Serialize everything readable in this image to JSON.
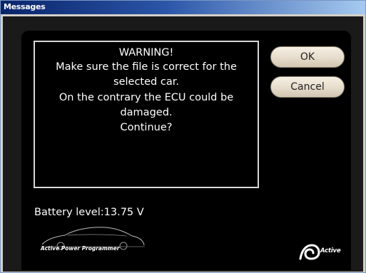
{
  "window": {
    "title": "Messages"
  },
  "message": {
    "lines": [
      "WARNING!",
      "Make sure the file is correct for the",
      "selected car.",
      "On the contrary the ECU could be",
      "damaged.",
      "Continue?"
    ]
  },
  "buttons": {
    "ok_label": "OK",
    "cancel_label": "Cancel"
  },
  "status": {
    "battery_text": "Battery level:13.75 V"
  },
  "branding": {
    "app_name": "Active Power Programmer",
    "brand_name": "Active",
    "car_icon": "car-silhouette-icon",
    "brand_icon": "active-brand-icon"
  },
  "colors": {
    "title_bar": "#0a246a",
    "panel_background": "#000000",
    "button_face": "#e6dccb",
    "text": "#ffffff"
  }
}
